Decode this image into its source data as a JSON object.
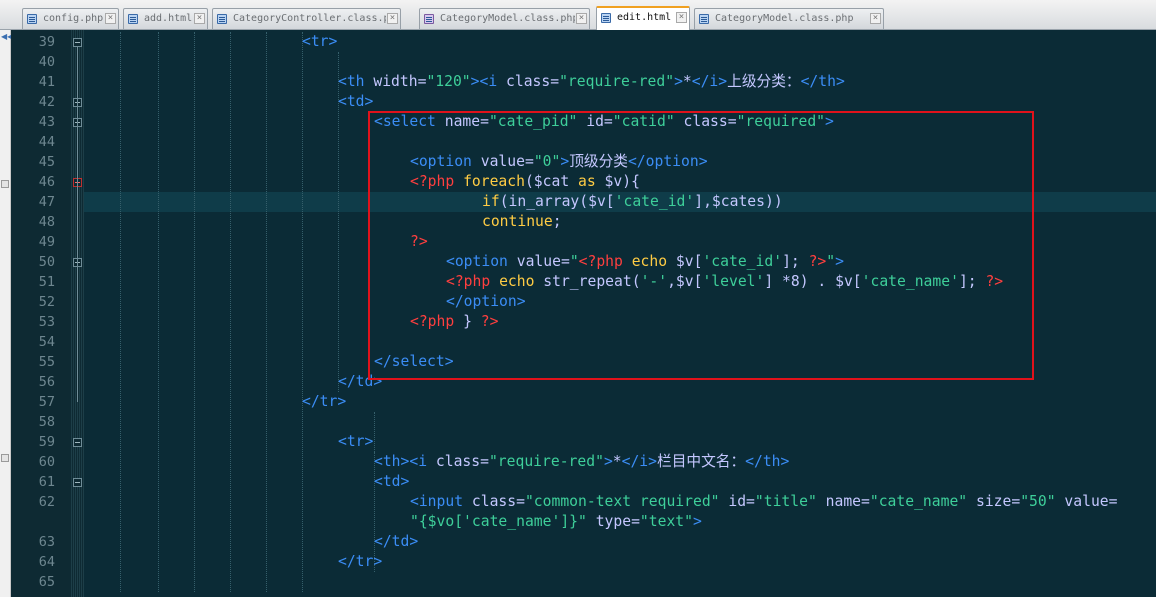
{
  "tabs": [
    {
      "label": "config.php",
      "icon": "php-file-icon"
    },
    {
      "label": "add.html",
      "icon": "html-file-icon"
    },
    {
      "label": "CategoryController.class.php",
      "icon": "php-file-icon"
    },
    {
      "label": "CategoryModel.class.php",
      "icon": "php-class-file-icon"
    },
    {
      "label": "edit.html",
      "icon": "html-file-icon",
      "active": true
    },
    {
      "label": "CategoryModel.class.php",
      "icon": "php-file-icon"
    }
  ],
  "colors": {
    "background": "#0b2b36",
    "tag": "#3b8df5",
    "string": "#3ecf9a",
    "php_delimiter": "#ff3f3f",
    "keyword": "#ffcc44",
    "text": "#c4c7ff",
    "highlight_box": "#e0121b"
  },
  "line_numbers": [
    "39",
    "40",
    "41",
    "42",
    "43",
    "44",
    "45",
    "46",
    "47",
    "48",
    "49",
    "50",
    "51",
    "52",
    "53",
    "54",
    "55",
    "56",
    "57",
    "58",
    "59",
    "60",
    "61",
    "62",
    "",
    "63",
    "64",
    "65"
  ],
  "code_lines": [
    [
      [
        "tg",
        "<tr>"
      ]
    ],
    [],
    [
      [
        "tg",
        "<th "
      ],
      [
        "at",
        "width="
      ],
      [
        "st",
        "\"120\""
      ],
      [
        "tg",
        "><i "
      ],
      [
        "at",
        "class="
      ],
      [
        "st",
        "\"require-red\""
      ],
      [
        "tg",
        ">"
      ],
      [
        "tx",
        "*"
      ],
      [
        "tg",
        "</i>"
      ],
      [
        "tx",
        "上级分类："
      ],
      [
        "tg",
        "</th>"
      ]
    ],
    [
      [
        "tg",
        "<td>"
      ]
    ],
    [
      [
        "tg",
        "<select "
      ],
      [
        "at",
        "name="
      ],
      [
        "st",
        "\"cate_pid\""
      ],
      [
        "at",
        " id="
      ],
      [
        "st",
        "\"catid\""
      ],
      [
        "at",
        " class="
      ],
      [
        "st",
        "\"required\""
      ],
      [
        "tg",
        ">"
      ]
    ],
    [],
    [
      [
        "tg",
        "<option "
      ],
      [
        "at",
        "value="
      ],
      [
        "st",
        "\"0\""
      ],
      [
        "tg",
        ">"
      ],
      [
        "tx",
        "顶级分类"
      ],
      [
        "tg",
        "</option>"
      ]
    ],
    [
      [
        "ph",
        "<?php "
      ],
      [
        "kw",
        "foreach"
      ],
      [
        "va",
        "($cat "
      ],
      [
        "kw",
        "as"
      ],
      [
        "va",
        " $v){"
      ]
    ],
    [
      [
        "kw",
        "if"
      ],
      [
        "va",
        "(in_array($v["
      ],
      [
        "st",
        "'cate_id'"
      ],
      [
        "va",
        "],$cates))"
      ]
    ],
    [
      [
        "kw",
        "continue"
      ],
      [
        "va",
        ";"
      ]
    ],
    [
      [
        "ph",
        "?>"
      ]
    ],
    [
      [
        "tg",
        "<option "
      ],
      [
        "at",
        "value="
      ],
      [
        "st",
        "\""
      ],
      [
        "ph",
        "<?php "
      ],
      [
        "kw",
        "echo"
      ],
      [
        "va",
        " $v["
      ],
      [
        "st",
        "'cate_id'"
      ],
      [
        "va",
        "]; "
      ],
      [
        "ph",
        "?>"
      ],
      [
        "st",
        "\""
      ],
      [
        "tg",
        ">"
      ]
    ],
    [
      [
        "ph",
        "<?php "
      ],
      [
        "kw",
        "echo"
      ],
      [
        "va",
        " str_repeat("
      ],
      [
        "st",
        "'-'"
      ],
      [
        "va",
        ",$v["
      ],
      [
        "st",
        "'level'"
      ],
      [
        "va",
        "] *8) . $v["
      ],
      [
        "st",
        "'cate_name'"
      ],
      [
        "va",
        "]; "
      ],
      [
        "ph",
        "?>"
      ]
    ],
    [
      [
        "tg",
        "</option>"
      ]
    ],
    [
      [
        "ph",
        "<?php "
      ],
      [
        "va",
        "} "
      ],
      [
        "ph",
        "?>"
      ]
    ],
    [],
    [
      [
        "tg",
        "</select>"
      ]
    ],
    [
      [
        "tg",
        "</td>"
      ]
    ],
    [
      [
        "tg",
        "</tr>"
      ]
    ],
    [],
    [
      [
        "tg",
        "<tr>"
      ]
    ],
    [
      [
        "tg",
        "<th><i "
      ],
      [
        "at",
        "class="
      ],
      [
        "st",
        "\"require-red\""
      ],
      [
        "tg",
        ">"
      ],
      [
        "tx",
        "*"
      ],
      [
        "tg",
        "</i>"
      ],
      [
        "tx",
        "栏目中文名："
      ],
      [
        "tg",
        "</th>"
      ]
    ],
    [
      [
        "tg",
        "<td>"
      ]
    ],
    [
      [
        "tg",
        "<input "
      ],
      [
        "at",
        "class="
      ],
      [
        "st",
        "\"common-text required\""
      ],
      [
        "at",
        " id="
      ],
      [
        "st",
        "\"title\""
      ],
      [
        "at",
        " name="
      ],
      [
        "st",
        "\"cate_name\""
      ],
      [
        "at",
        " size="
      ],
      [
        "st",
        "\"50\""
      ],
      [
        "at",
        " value="
      ]
    ],
    [
      [
        "st",
        "\"{$vo['cate_name']}\""
      ],
      [
        "at",
        " type="
      ],
      [
        "st",
        "\"text\""
      ],
      [
        "tg",
        ">"
      ]
    ],
    [
      [
        "tg",
        "</td>"
      ]
    ],
    [
      [
        "tg",
        "</tr>"
      ]
    ],
    []
  ]
}
